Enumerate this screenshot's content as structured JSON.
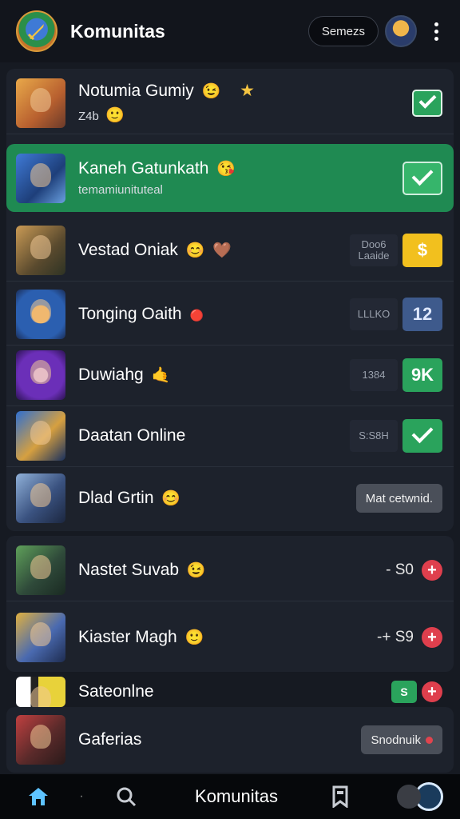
{
  "header": {
    "title": "Komunitas",
    "search_label": "Semezs"
  },
  "rows": [
    {
      "title": "Notumia Gumiy",
      "title_emoji": "😉",
      "star": "★",
      "subtitle": "Z4b",
      "subtitle_emoji": "🙂",
      "badge": "check",
      "badge_color": "#2aa35c"
    },
    {
      "title": "Kaneh Gatunkath",
      "title_emoji": "😘",
      "subtitle": "temamiunituteal",
      "badge": "check",
      "badge_color": "#36b56b",
      "highlight_color": "#1f8a52"
    },
    {
      "title": "Vestad Oniak",
      "title_emoji": "😊",
      "title_emoji2": "🤎",
      "meta": "Doo6 Laaide",
      "badge": "$",
      "badge_color": "#f2c01e"
    },
    {
      "title": "Tonging Oaith",
      "title_emoji": "🔴",
      "meta": "LLLKO",
      "badge": "12",
      "badge_color": "#3e5a8c"
    },
    {
      "title": "Duwiahg",
      "title_emoji": "🤙",
      "meta": "1384",
      "badge": "9K",
      "badge_color": "#2aa35c"
    },
    {
      "title": "Daatan Online",
      "meta": "S:S8H",
      "badge": "check",
      "badge_color": "#2aa35c"
    },
    {
      "title": "Dlad Grtin",
      "title_emoji": "😊",
      "action": "Mat cetwnid."
    },
    {
      "title": "Nastet Suvab",
      "title_emoji": "😉",
      "stat": "- S0"
    },
    {
      "title": "Kiaster Magh",
      "title_emoji": "🙂",
      "stat": "-+ S9"
    },
    {
      "title": "Sateonlne",
      "badge": "S"
    },
    {
      "title": "Gaferias",
      "action": "Snodnuik"
    }
  ],
  "bottom_nav": {
    "label": "Komunitas",
    "dot": "·"
  }
}
